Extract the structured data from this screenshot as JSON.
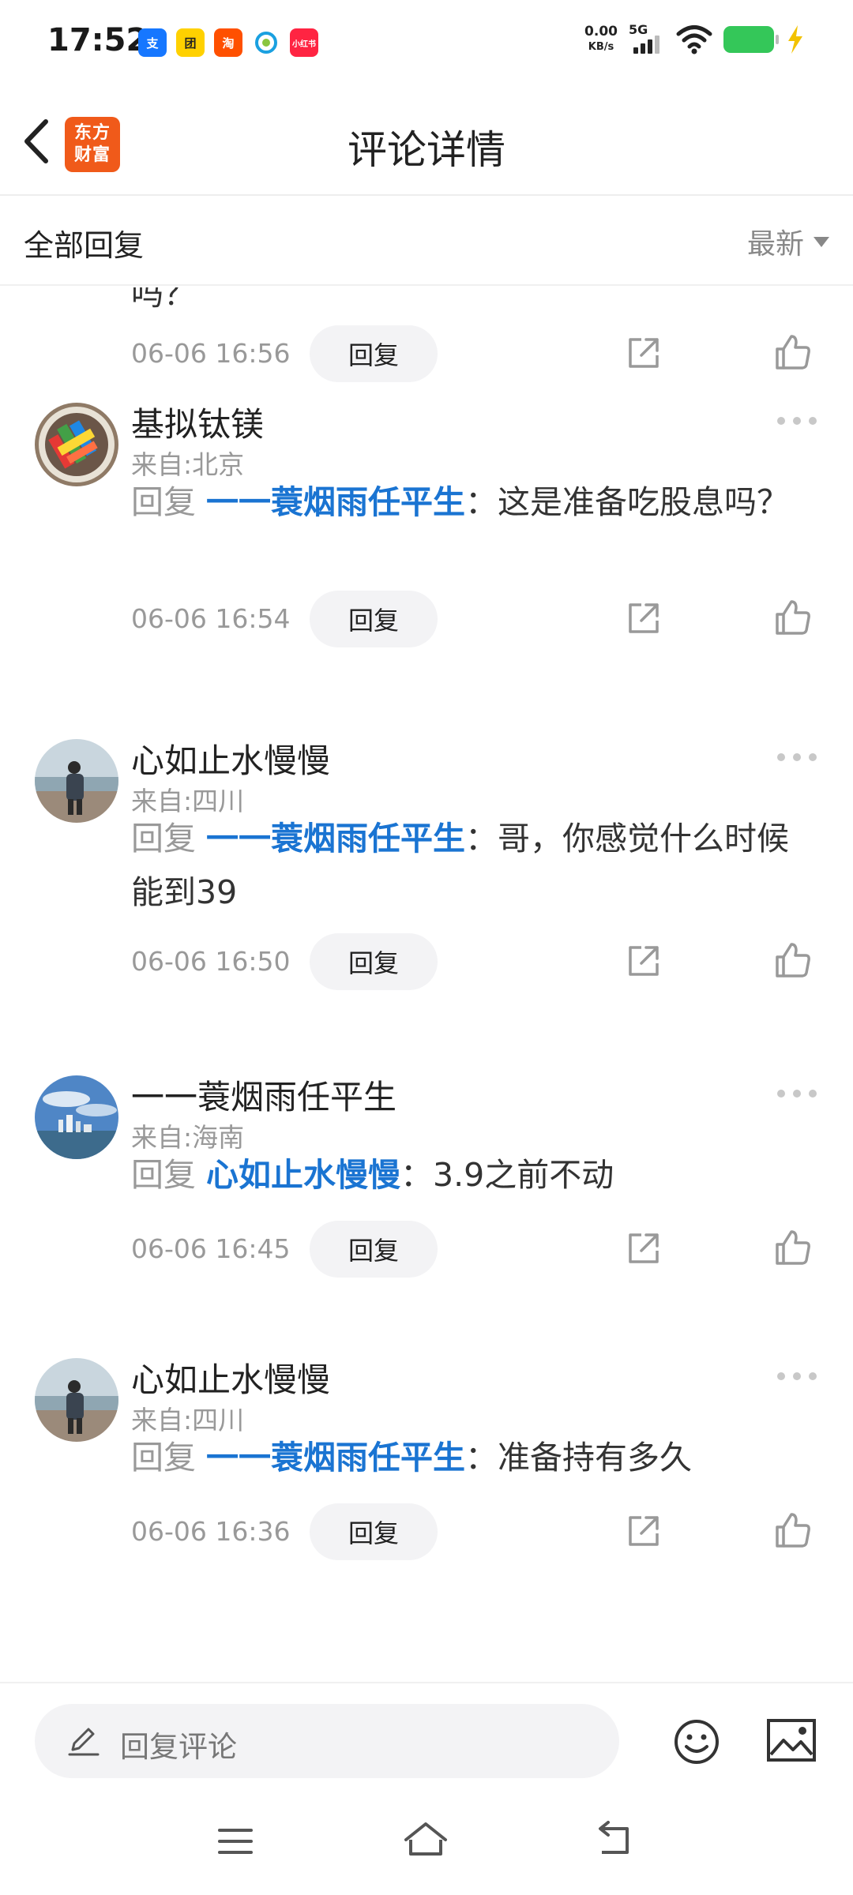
{
  "status_bar": {
    "time": "17:52",
    "net_speed_value": "0.00",
    "net_speed_unit": "KB/s",
    "signal_label": "5G",
    "app_icons": [
      {
        "name": "alipay-icon",
        "label": "支",
        "color": "#1677ff"
      },
      {
        "name": "meituan-icon",
        "label": "团",
        "color": "#ffd100"
      },
      {
        "name": "taobao-icon",
        "label": "淘",
        "color": "#ff5000"
      },
      {
        "name": "china-mobile-icon",
        "label": "",
        "color": "#ffffff"
      },
      {
        "name": "xiaohongshu-icon",
        "label": "小红书",
        "color": "#ff2442"
      }
    ]
  },
  "header": {
    "title": "评论详情",
    "logo_line1": "东方",
    "logo_line2": "财富",
    "logo_color": "#f05a1a"
  },
  "section": {
    "title": "全部回复",
    "sort": "最新"
  },
  "colors": {
    "mention": "#1a74d2",
    "muted": "#999999"
  },
  "comments": [
    {
      "fragment": "吗？",
      "date": "06-06 16:56",
      "reply_label": "回复"
    },
    {
      "avatar": "avatar-colorful-blocks",
      "username": "基拟钛镁",
      "location": "来自:北京",
      "reply_prefix": "回复",
      "reply_to": "一一蓑烟雨任平生",
      "text": "：这是准备吃股息吗？",
      "date": "06-06 16:54",
      "reply_label": "回复"
    },
    {
      "avatar": "avatar-person-riverside",
      "username": "心如止水慢慢",
      "location": "来自:四川",
      "reply_prefix": "回复",
      "reply_to": "一一蓑烟雨任平生",
      "text": "：哥，你感觉什么时候能到39",
      "date": "06-06 16:50",
      "reply_label": "回复"
    },
    {
      "avatar": "avatar-city-sky",
      "username": "一一蓑烟雨任平生",
      "location": "来自:海南",
      "reply_prefix": "回复",
      "reply_to": "心如止水慢慢",
      "text": "：3.9之前不动",
      "date": "06-06 16:45",
      "reply_label": "回复"
    },
    {
      "avatar": "avatar-person-riverside",
      "username": "心如止水慢慢",
      "location": "来自:四川",
      "reply_prefix": "回复",
      "reply_to": "一一蓑烟雨任平生",
      "text": "：准备持有多久",
      "date": "06-06 16:36",
      "reply_label": "回复"
    }
  ],
  "bottom_bar": {
    "input_placeholder": "回复评论"
  }
}
